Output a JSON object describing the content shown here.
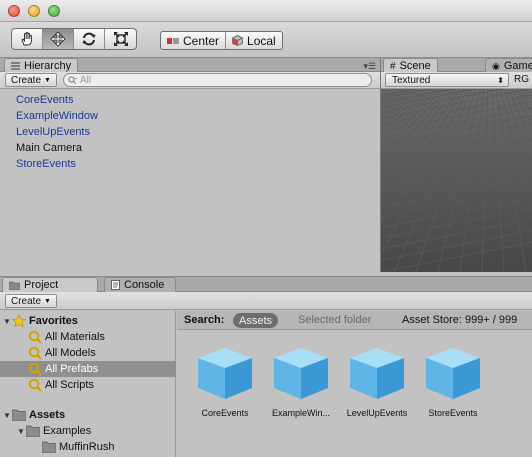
{
  "toolbar": {
    "tools": [
      {
        "name": "hand-tool",
        "icon": "hand-icon",
        "active": false
      },
      {
        "name": "move-tool",
        "icon": "move-icon",
        "active": true
      },
      {
        "name": "rotate-tool",
        "icon": "rotate-icon",
        "active": false
      },
      {
        "name": "scale-tool",
        "icon": "scale-icon",
        "active": false
      }
    ],
    "pivot_center_label": "Center",
    "pivot_local_label": "Local"
  },
  "hierarchy": {
    "tab_label": "Hierarchy",
    "create_label": "Create",
    "search_placeholder": "All",
    "items": [
      {
        "label": "CoreEvents",
        "kind": "prefab"
      },
      {
        "label": "ExampleWindow",
        "kind": "prefab"
      },
      {
        "label": "LevelUpEvents",
        "kind": "prefab"
      },
      {
        "label": "Main Camera",
        "kind": "plain"
      },
      {
        "label": "StoreEvents",
        "kind": "prefab"
      }
    ]
  },
  "scene": {
    "tab_scene": "Scene",
    "tab_game": "Game",
    "render_mode": "Textured",
    "rgb_label": "RG"
  },
  "project": {
    "tab_project": "Project",
    "tab_console": "Console",
    "create_label": "Create",
    "tree": [
      {
        "label": "Favorites",
        "bold": true,
        "icon": "star-icon",
        "level": 0,
        "expanded": true
      },
      {
        "label": "All Materials",
        "icon": "search-icon",
        "level": 1
      },
      {
        "label": "All Models",
        "icon": "search-icon",
        "level": 1
      },
      {
        "label": "All Prefabs",
        "icon": "search-icon",
        "level": 1,
        "selected": true
      },
      {
        "label": "All Scripts",
        "icon": "search-icon",
        "level": 1
      },
      {
        "label": "Assets",
        "bold": true,
        "icon": "folder-icon",
        "level": 0,
        "expanded": true
      },
      {
        "label": "Examples",
        "icon": "folder-icon",
        "level": 1,
        "expanded": true
      },
      {
        "label": "MuffinRush",
        "icon": "folder-icon",
        "level": 2
      }
    ],
    "search_label": "Search:",
    "scope_assets": "Assets",
    "scope_selected": "Selected folder",
    "asset_store": "Asset Store: 999+ / 999",
    "assets": [
      {
        "label": "CoreEvents"
      },
      {
        "label": "ExampleWin..."
      },
      {
        "label": "LevelUpEvents"
      },
      {
        "label": "StoreEvents"
      }
    ]
  },
  "colors": {
    "prefab_text": "#1a3a9a",
    "selected_row": "#8f8f8f",
    "cube_light": "#8fd3f5",
    "cube_dark": "#2f8fcf"
  }
}
